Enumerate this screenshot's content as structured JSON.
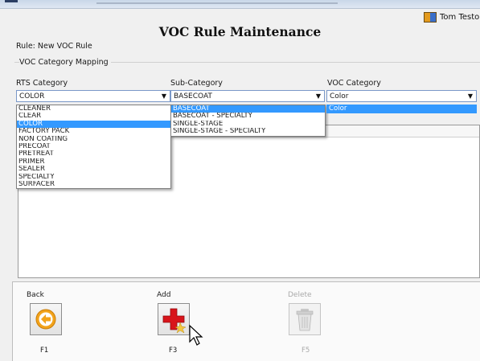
{
  "user": {
    "name": "Tom Testo"
  },
  "page": {
    "title": "VOC Rule Maintenance",
    "rule_label": "Rule: New VOC Rule",
    "group_label": "VOC Category Mapping"
  },
  "rts": {
    "label": "RTS Category",
    "selected": "COLOR",
    "options": [
      "CLEANER",
      "CLEAR",
      "COLOR",
      "FACTORY PACK",
      "NON COATING",
      "PRECOAT",
      "PRETREAT",
      "PRIMER",
      "SEALER",
      "SPECIALTY",
      "SURFACER"
    ]
  },
  "sub": {
    "label": "Sub-Category",
    "selected": "BASECOAT",
    "options": [
      "BASECOAT",
      "BASECOAT - SPECIALTY",
      "SINGLE-STAGE",
      "SINGLE-STAGE - SPECIALTY"
    ]
  },
  "voc": {
    "label": "VOC Category",
    "selected": "Color",
    "options": [
      "Color"
    ]
  },
  "buttons": {
    "back": {
      "label": "Back",
      "key": "F1"
    },
    "add": {
      "label": "Add",
      "key": "F3"
    },
    "delete": {
      "label": "Delete",
      "key": "F5"
    }
  },
  "colors": {
    "selection": "#3399ff",
    "accent_orange": "#f2a31b",
    "add_red": "#d8141b"
  }
}
